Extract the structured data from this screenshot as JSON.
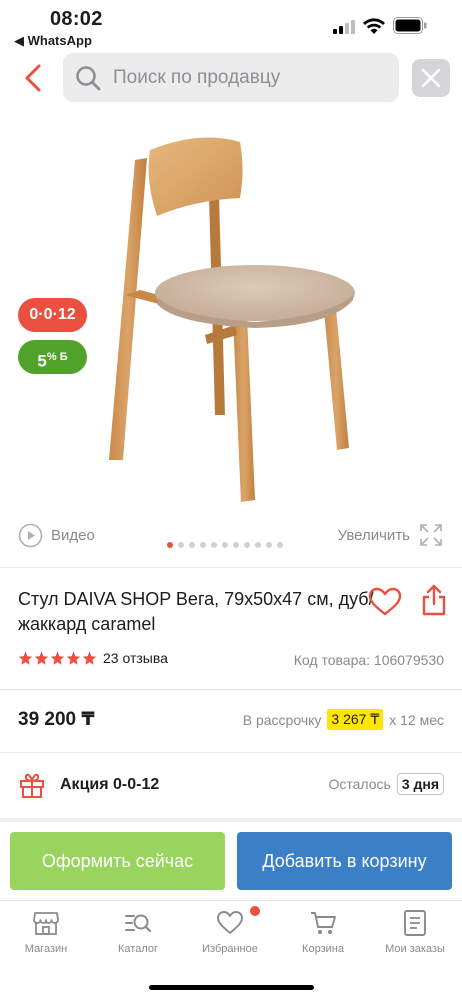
{
  "status_bar": {
    "time": "08:02",
    "back_app": "◀ WhatsApp"
  },
  "search": {
    "placeholder": "Поиск по продавцу"
  },
  "badges": {
    "credit": "0·0·12",
    "bonus_value": "5",
    "bonus_unit": "% Б"
  },
  "gallery": {
    "video_label": "Видео",
    "zoom_label": "Увеличить",
    "total_images": 11,
    "active_image": 1
  },
  "product": {
    "title": "Стул DAIVA SHOP Вега, 79x50x47 см, дуб/жаккард caramel",
    "rating_stars": 5,
    "reviews": "23 отзыва",
    "sku": "Код товара: 106079530",
    "price": "39 200 ₸",
    "installment_prefix": "В рассрочку",
    "installment_value": "3 267 ₸",
    "installment_suffix": "x 12 мес"
  },
  "promo": {
    "label": "Акция 0-0-12",
    "remain_prefix": "Осталось",
    "remain_value": "3 дня"
  },
  "actions": {
    "buy_now": "Оформить сейчас",
    "add_to_cart": "Добавить в корзину"
  },
  "tabbar": {
    "items": [
      {
        "label": "Магазин",
        "icon": "store-icon"
      },
      {
        "label": "Каталог",
        "icon": "catalog-icon"
      },
      {
        "label": "Избранное",
        "icon": "heart-icon"
      },
      {
        "label": "Корзина",
        "icon": "cart-icon"
      },
      {
        "label": "Мои заказы",
        "icon": "orders-icon"
      }
    ]
  },
  "colors": {
    "accent_red": "#e9503f",
    "buy_green": "#98d45e",
    "cart_blue": "#3b7fc7",
    "bonus_green": "#4fa32b",
    "installment_yellow": "#ffe600"
  }
}
